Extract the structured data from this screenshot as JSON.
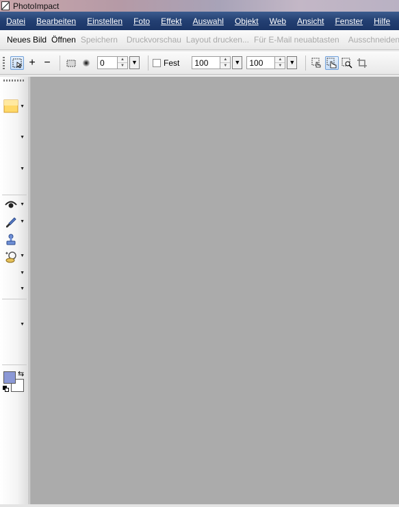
{
  "window": {
    "title": "PhotoImpact"
  },
  "menu": [
    {
      "label": "Datei"
    },
    {
      "label": "Bearbeiten"
    },
    {
      "label": "Einstellen"
    },
    {
      "label": "Foto"
    },
    {
      "label": "Effekt"
    },
    {
      "label": "Auswahl"
    },
    {
      "label": "Objekt"
    },
    {
      "label": "Web"
    },
    {
      "label": "Ansicht"
    },
    {
      "label": "Fenster"
    },
    {
      "label": "Hilfe"
    }
  ],
  "standard_toolbar": {
    "new_image": "Neues Bild",
    "open": "Öffnen",
    "save": "Speichern",
    "print_preview": "Druckvorschau",
    "print_layout": "Layout drucken...",
    "email_rescan": "Für E-Mail neuabtasten",
    "cut": "Ausschneiden"
  },
  "attribute_toolbar": {
    "soft_edge_value": "0",
    "fixed_label": "Fest",
    "width_value": "100",
    "height_value": "100"
  },
  "colors": {
    "foreground": "#8b98d6",
    "background": "#ffffff",
    "workspace": "#ababab",
    "menubar": "#233f72"
  }
}
